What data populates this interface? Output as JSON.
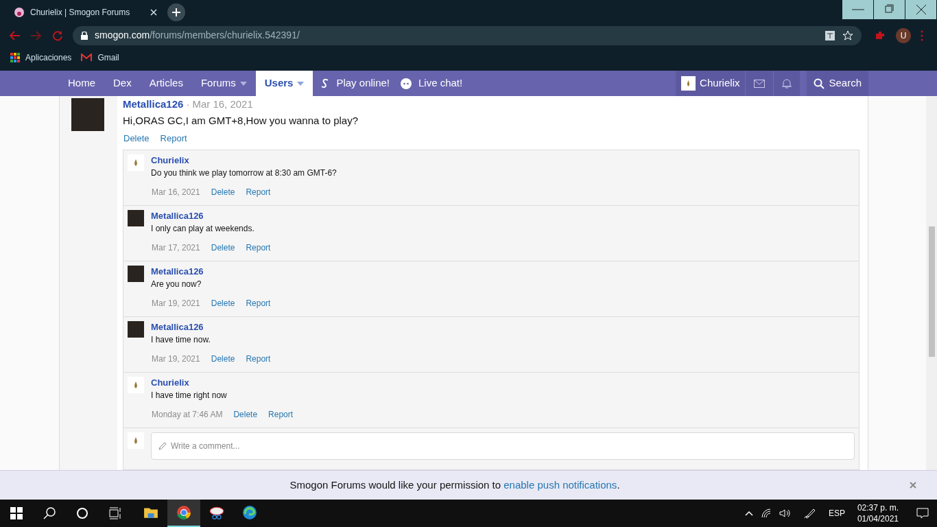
{
  "browser": {
    "tab_title": "Churielix | Smogon Forums",
    "url_host": "smogon.com",
    "url_path": "/forums/members/churielix.542391/",
    "bookmarks": [
      "Aplicaciones",
      "Gmail"
    ],
    "profile": "U"
  },
  "nav": {
    "items": [
      {
        "label": "Home",
        "selected": false,
        "dropdown": false
      },
      {
        "label": "Dex",
        "selected": false,
        "dropdown": false
      },
      {
        "label": "Articles",
        "selected": false,
        "dropdown": false
      },
      {
        "label": "Forums",
        "selected": false,
        "dropdown": true
      },
      {
        "label": "Users",
        "selected": true,
        "dropdown": true
      }
    ],
    "play": "Play online!",
    "chat": "Live chat!",
    "user": "Churielix",
    "search": "Search"
  },
  "post": {
    "author": "Metallica126",
    "separator": "·",
    "date": "Mar 16, 2021",
    "body": "Hi,ORAS GC,I am GMT+8,How you wanna to play?",
    "actions": [
      "Delete",
      "Report"
    ]
  },
  "replies": [
    {
      "author": "Churielix",
      "kind": "logo",
      "text": "Do you think we play tomorrow at 8:30 am GMT-6?",
      "date": "Mar 16, 2021",
      "actions": [
        "Delete",
        "Report"
      ]
    },
    {
      "author": "Metallica126",
      "kind": "photo",
      "text": "I only can play at weekends.",
      "date": "Mar 17, 2021",
      "actions": [
        "Delete",
        "Report"
      ]
    },
    {
      "author": "Metallica126",
      "kind": "photo",
      "text": "Are you now?",
      "date": "Mar 19, 2021",
      "actions": [
        "Delete",
        "Report"
      ]
    },
    {
      "author": "Metallica126",
      "kind": "photo",
      "text": "I have time now.",
      "date": "Mar 19, 2021",
      "actions": [
        "Delete",
        "Report"
      ]
    },
    {
      "author": "Churielix",
      "kind": "logo",
      "text": "I have time right now",
      "date": "Monday at 7:46 AM",
      "actions": [
        "Delete",
        "Report"
      ]
    }
  ],
  "comment_box": {
    "placeholder": "Write a comment..."
  },
  "notice": {
    "before": "Smogon Forums would like your permission to",
    "link": "enable push notifications",
    "after": "."
  },
  "taskbar": {
    "apps": [
      {
        "kind": "explorer",
        "active": false
      },
      {
        "kind": "chrome",
        "active": true
      },
      {
        "kind": "snip",
        "active": false
      },
      {
        "kind": "edge",
        "active": false
      }
    ],
    "language": "ESP",
    "time": "02:37 p. m.",
    "date": "01/04/2021"
  }
}
